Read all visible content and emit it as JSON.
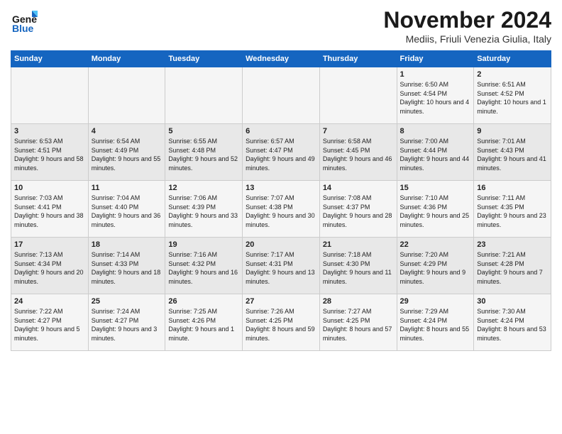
{
  "logo": {
    "line1": "General",
    "line2": "Blue"
  },
  "title": "November 2024",
  "subtitle": "Mediis, Friuli Venezia Giulia, Italy",
  "days_header": [
    "Sunday",
    "Monday",
    "Tuesday",
    "Wednesday",
    "Thursday",
    "Friday",
    "Saturday"
  ],
  "weeks": [
    [
      {
        "day": "",
        "info": ""
      },
      {
        "day": "",
        "info": ""
      },
      {
        "day": "",
        "info": ""
      },
      {
        "day": "",
        "info": ""
      },
      {
        "day": "",
        "info": ""
      },
      {
        "day": "1",
        "info": "Sunrise: 6:50 AM\nSunset: 4:54 PM\nDaylight: 10 hours and 4 minutes."
      },
      {
        "day": "2",
        "info": "Sunrise: 6:51 AM\nSunset: 4:52 PM\nDaylight: 10 hours and 1 minute."
      }
    ],
    [
      {
        "day": "3",
        "info": "Sunrise: 6:53 AM\nSunset: 4:51 PM\nDaylight: 9 hours and 58 minutes."
      },
      {
        "day": "4",
        "info": "Sunrise: 6:54 AM\nSunset: 4:49 PM\nDaylight: 9 hours and 55 minutes."
      },
      {
        "day": "5",
        "info": "Sunrise: 6:55 AM\nSunset: 4:48 PM\nDaylight: 9 hours and 52 minutes."
      },
      {
        "day": "6",
        "info": "Sunrise: 6:57 AM\nSunset: 4:47 PM\nDaylight: 9 hours and 49 minutes."
      },
      {
        "day": "7",
        "info": "Sunrise: 6:58 AM\nSunset: 4:45 PM\nDaylight: 9 hours and 46 minutes."
      },
      {
        "day": "8",
        "info": "Sunrise: 7:00 AM\nSunset: 4:44 PM\nDaylight: 9 hours and 44 minutes."
      },
      {
        "day": "9",
        "info": "Sunrise: 7:01 AM\nSunset: 4:43 PM\nDaylight: 9 hours and 41 minutes."
      }
    ],
    [
      {
        "day": "10",
        "info": "Sunrise: 7:03 AM\nSunset: 4:41 PM\nDaylight: 9 hours and 38 minutes."
      },
      {
        "day": "11",
        "info": "Sunrise: 7:04 AM\nSunset: 4:40 PM\nDaylight: 9 hours and 36 minutes."
      },
      {
        "day": "12",
        "info": "Sunrise: 7:06 AM\nSunset: 4:39 PM\nDaylight: 9 hours and 33 minutes."
      },
      {
        "day": "13",
        "info": "Sunrise: 7:07 AM\nSunset: 4:38 PM\nDaylight: 9 hours and 30 minutes."
      },
      {
        "day": "14",
        "info": "Sunrise: 7:08 AM\nSunset: 4:37 PM\nDaylight: 9 hours and 28 minutes."
      },
      {
        "day": "15",
        "info": "Sunrise: 7:10 AM\nSunset: 4:36 PM\nDaylight: 9 hours and 25 minutes."
      },
      {
        "day": "16",
        "info": "Sunrise: 7:11 AM\nSunset: 4:35 PM\nDaylight: 9 hours and 23 minutes."
      }
    ],
    [
      {
        "day": "17",
        "info": "Sunrise: 7:13 AM\nSunset: 4:34 PM\nDaylight: 9 hours and 20 minutes."
      },
      {
        "day": "18",
        "info": "Sunrise: 7:14 AM\nSunset: 4:33 PM\nDaylight: 9 hours and 18 minutes."
      },
      {
        "day": "19",
        "info": "Sunrise: 7:16 AM\nSunset: 4:32 PM\nDaylight: 9 hours and 16 minutes."
      },
      {
        "day": "20",
        "info": "Sunrise: 7:17 AM\nSunset: 4:31 PM\nDaylight: 9 hours and 13 minutes."
      },
      {
        "day": "21",
        "info": "Sunrise: 7:18 AM\nSunset: 4:30 PM\nDaylight: 9 hours and 11 minutes."
      },
      {
        "day": "22",
        "info": "Sunrise: 7:20 AM\nSunset: 4:29 PM\nDaylight: 9 hours and 9 minutes."
      },
      {
        "day": "23",
        "info": "Sunrise: 7:21 AM\nSunset: 4:28 PM\nDaylight: 9 hours and 7 minutes."
      }
    ],
    [
      {
        "day": "24",
        "info": "Sunrise: 7:22 AM\nSunset: 4:27 PM\nDaylight: 9 hours and 5 minutes."
      },
      {
        "day": "25",
        "info": "Sunrise: 7:24 AM\nSunset: 4:27 PM\nDaylight: 9 hours and 3 minutes."
      },
      {
        "day": "26",
        "info": "Sunrise: 7:25 AM\nSunset: 4:26 PM\nDaylight: 9 hours and 1 minute."
      },
      {
        "day": "27",
        "info": "Sunrise: 7:26 AM\nSunset: 4:25 PM\nDaylight: 8 hours and 59 minutes."
      },
      {
        "day": "28",
        "info": "Sunrise: 7:27 AM\nSunset: 4:25 PM\nDaylight: 8 hours and 57 minutes."
      },
      {
        "day": "29",
        "info": "Sunrise: 7:29 AM\nSunset: 4:24 PM\nDaylight: 8 hours and 55 minutes."
      },
      {
        "day": "30",
        "info": "Sunrise: 7:30 AM\nSunset: 4:24 PM\nDaylight: 8 hours and 53 minutes."
      }
    ]
  ]
}
